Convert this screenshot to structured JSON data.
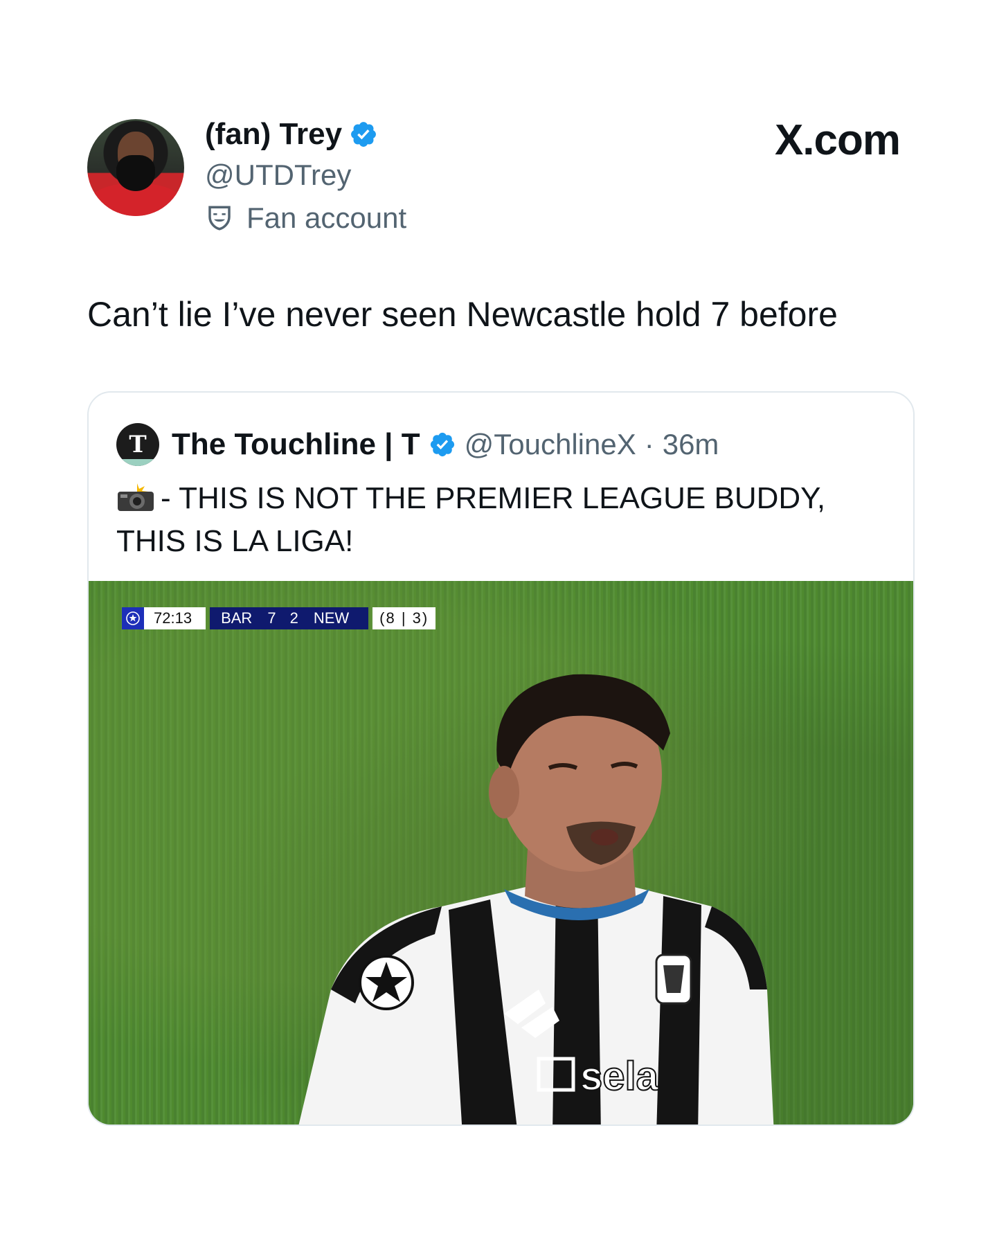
{
  "header": {
    "display_name": "(fan) Trey",
    "handle": "@UTDTrey",
    "fan_label": "Fan account",
    "brand": "X.com"
  },
  "tweet": {
    "text": "Can’t lie I’ve never seen Newcastle hold 7 before"
  },
  "quote": {
    "avatar_letter": "T",
    "name": "The Touchline | T",
    "handle": "@TouchlineX",
    "separator": "·",
    "time": "36m",
    "text": "- THIS IS NOT THE PREMIER LEAGUE BUDDY, THIS IS LA LIGA!",
    "emoji_icon": "camera-flash-icon"
  },
  "scoreboard": {
    "clock": "72:13",
    "home": "BAR",
    "home_score": "7",
    "away_score": "2",
    "away": "NEW",
    "aggregate": "(8 | 3)"
  },
  "colors": {
    "verified": "#1d9bf0",
    "secondary_text": "#536471",
    "pitch": "#4e8a32",
    "scoreboard_navy": "#0f1a6e"
  }
}
